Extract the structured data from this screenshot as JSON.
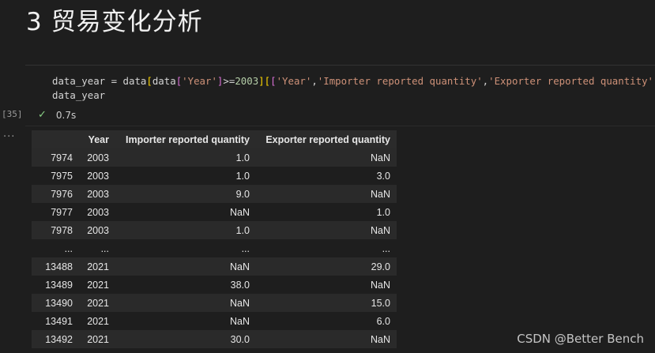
{
  "markdown": {
    "heading": "3 贸易变化分析"
  },
  "cell": {
    "execution_count": "[35]",
    "status_time": "0.7s",
    "output_ellipsis": "...",
    "code": {
      "line1": {
        "var": "data_year",
        "assign": " = ",
        "obj1": "data",
        "br_open1": "[",
        "obj2": "data",
        "br_open2": "[",
        "str_year_filter": "'Year'",
        "br_close2": "]",
        "cmp": ">=",
        "num": "2003",
        "br_close1": "]",
        "br_open3": "[",
        "br_open4": "[",
        "str_col1": "'Year'",
        "comma1": ",",
        "str_col2": "'Importer reported quantity'",
        "comma2": ",",
        "str_col3": "'Exporter reported quantity'",
        "br_close4": "]",
        "br_close3": "]"
      },
      "line2": "data_year"
    }
  },
  "table": {
    "columns": [
      "",
      "Year",
      "Importer reported quantity",
      "Exporter reported quantity"
    ],
    "rows": [
      [
        "7974",
        "2003",
        "1.0",
        "NaN"
      ],
      [
        "7975",
        "2003",
        "1.0",
        "3.0"
      ],
      [
        "7976",
        "2003",
        "9.0",
        "NaN"
      ],
      [
        "7977",
        "2003",
        "NaN",
        "1.0"
      ],
      [
        "7978",
        "2003",
        "1.0",
        "NaN"
      ],
      [
        "...",
        "...",
        "...",
        "..."
      ],
      [
        "13488",
        "2021",
        "NaN",
        "29.0"
      ],
      [
        "13489",
        "2021",
        "38.0",
        "NaN"
      ],
      [
        "13490",
        "2021",
        "NaN",
        "15.0"
      ],
      [
        "13491",
        "2021",
        "NaN",
        "6.0"
      ],
      [
        "13492",
        "2021",
        "30.0",
        "NaN"
      ]
    ]
  },
  "watermark": "CSDN @Better Bench",
  "colors": {
    "background": "#1e1e1e",
    "string": "#ce9178",
    "number": "#b5cea8",
    "success_check": "#89d185"
  },
  "icons": {
    "status": "check-icon"
  }
}
